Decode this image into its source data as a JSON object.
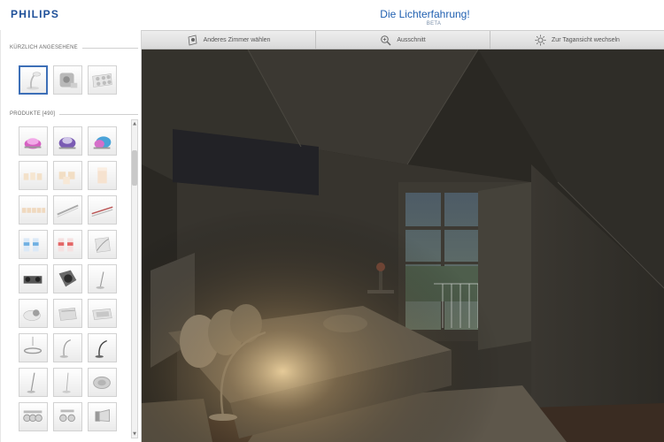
{
  "header": {
    "brand": "PHILIPS",
    "title": "Die Lichterfahrung!",
    "subtitle": "BETA"
  },
  "toolbar": {
    "buttons": [
      {
        "label": "Anderes Zimmer wählen",
        "icon": "room-pin-icon"
      },
      {
        "label": "Ausschnitt",
        "icon": "zoom-icon"
      },
      {
        "label": "Zur Tagansicht wechseln",
        "icon": "sun-icon"
      }
    ]
  },
  "sidebar": {
    "recent_title": "KÜRZLICH ANGESEHENE",
    "recent_items": [
      {
        "name": "desk-lamp-white",
        "selected": true
      },
      {
        "name": "wall-spot-grey",
        "selected": false
      },
      {
        "name": "ceiling-spot-panel",
        "selected": false
      }
    ],
    "products_title": "PRODUKTE [490]",
    "product_count": 490
  },
  "viewport": {
    "scene": "dark-bedroom-with-lamp"
  }
}
